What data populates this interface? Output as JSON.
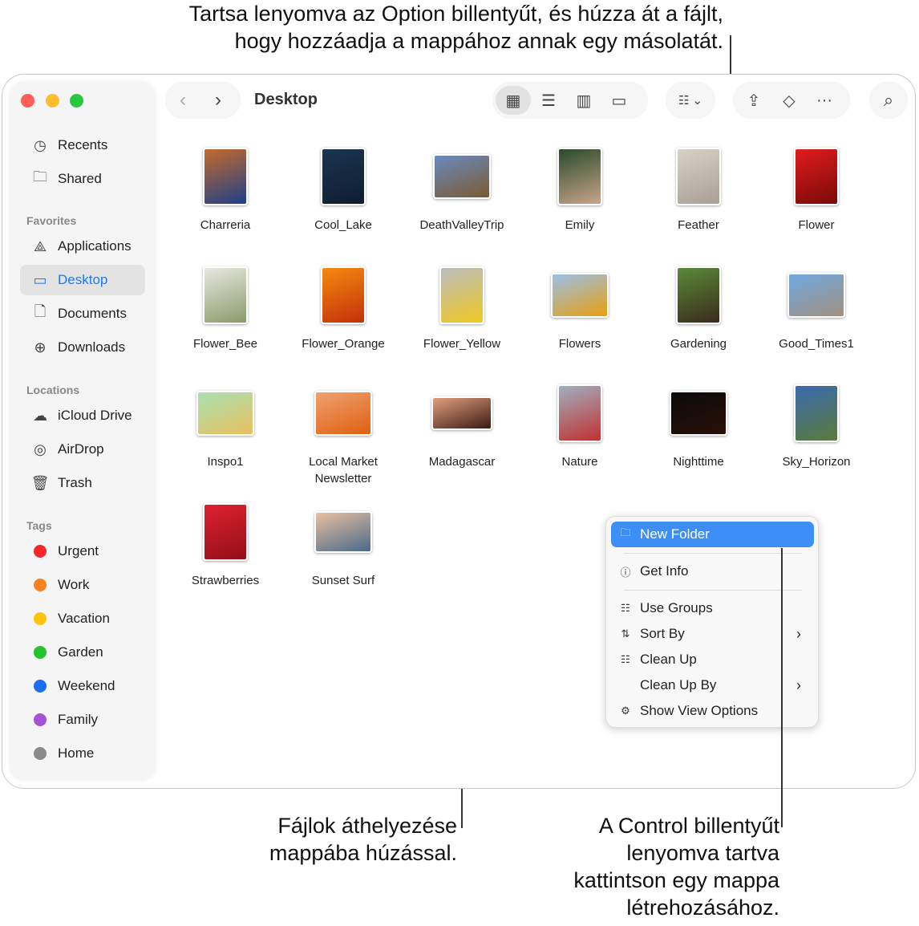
{
  "callouts": {
    "top": [
      "Tartsa lenyomva az Option billentyűt, és húzza át a fájlt,",
      "hogy hozzáadja a mappához annak egy másolatát."
    ],
    "middle": [
      "Fájlok áthelyezése",
      "mappába húzással."
    ],
    "right": [
      "A Control billentyűt",
      "lenyomva tartva",
      "kattintson egy mappa",
      "létrehozásához."
    ]
  },
  "window": {
    "title": "Desktop"
  },
  "sidebar": {
    "top": [
      {
        "label": "Recents",
        "icon": "clock-icon"
      },
      {
        "label": "Shared",
        "icon": "shared-folder-icon"
      }
    ],
    "favorites_heading": "Favorites",
    "favorites": [
      {
        "label": "Applications",
        "icon": "applications-icon"
      },
      {
        "label": "Desktop",
        "icon": "desktop-icon",
        "selected": true
      },
      {
        "label": "Documents",
        "icon": "document-icon"
      },
      {
        "label": "Downloads",
        "icon": "download-icon"
      }
    ],
    "locations_heading": "Locations",
    "locations": [
      {
        "label": "iCloud Drive",
        "icon": "cloud-icon"
      },
      {
        "label": "AirDrop",
        "icon": "airdrop-icon"
      },
      {
        "label": "Trash",
        "icon": "trash-icon"
      }
    ],
    "tags_heading": "Tags",
    "tags": [
      {
        "label": "Urgent",
        "color": "#f2262b"
      },
      {
        "label": "Work",
        "color": "#f6821f"
      },
      {
        "label": "Vacation",
        "color": "#fbc40b"
      },
      {
        "label": "Garden",
        "color": "#27c22f"
      },
      {
        "label": "Weekend",
        "color": "#1d6ff2"
      },
      {
        "label": "Family",
        "color": "#a651d6"
      },
      {
        "label": "Home",
        "color": "#8a8a8a"
      }
    ]
  },
  "files": [
    {
      "name": "Charreria",
      "c1": "#c46a2a",
      "c2": "#1f3f8a"
    },
    {
      "name": "Cool_Lake",
      "c1": "#1b3550",
      "c2": "#0d1d30"
    },
    {
      "name": "DeathValleyTrip",
      "c1": "#6a8ac0",
      "c2": "#7a5a30"
    },
    {
      "name": "Emily",
      "c1": "#2a4a2a",
      "c2": "#c9a48a"
    },
    {
      "name": "Feather",
      "c1": "#d8d2c6",
      "c2": "#a8a094"
    },
    {
      "name": "Flower",
      "c1": "#e01c1c",
      "c2": "#7a0a0a"
    },
    {
      "name": "Flower_Bee",
      "c1": "#e8e8e0",
      "c2": "#8a9a6a"
    },
    {
      "name": "Flower_Orange",
      "c1": "#f58a10",
      "c2": "#c2300a"
    },
    {
      "name": "Flower_Yellow",
      "c1": "#b8bcc0",
      "c2": "#f2c820"
    },
    {
      "name": "Flowers",
      "c1": "#9ac0e8",
      "c2": "#e8a010"
    },
    {
      "name": "Gardening",
      "c1": "#5a8a3a",
      "c2": "#3a2a1a"
    },
    {
      "name": "Good_Times1",
      "c1": "#70a8e0",
      "c2": "#a09080"
    },
    {
      "name": "Inspo1",
      "c1": "#a8e0b0",
      "c2": "#e8c060"
    },
    {
      "name": "Local Market\nNewsletter",
      "c1": "#f0a070",
      "c2": "#e06010"
    },
    {
      "name": "Madagascar",
      "c1": "#e0a080",
      "c2": "#3a1a10"
    },
    {
      "name": "Nature",
      "c1": "#a0b0c0",
      "c2": "#c03030"
    },
    {
      "name": "Nighttime",
      "c1": "#0a0a0a",
      "c2": "#2a1008"
    },
    {
      "name": "Sky_Horizon",
      "c1": "#3a6ab0",
      "c2": "#5a7a3a"
    },
    {
      "name": "Strawberries",
      "c1": "#e02030",
      "c2": "#901018"
    },
    {
      "name": "Sunset Surf",
      "c1": "#e8c0a0",
      "c2": "#4a6a8a"
    }
  ],
  "context_menu": {
    "items": [
      {
        "label": "New Folder",
        "icon": "new-folder-icon",
        "highlighted": true
      },
      {
        "label": "Get Info",
        "icon": "info-icon"
      },
      {
        "label": "Use Groups",
        "icon": "groups-icon"
      },
      {
        "label": "Sort By",
        "icon": "sort-icon",
        "submenu": true
      },
      {
        "label": "Clean Up",
        "icon": "grid-icon"
      },
      {
        "label": "Clean Up By",
        "icon": "",
        "submenu": true
      },
      {
        "label": "Show View Options",
        "icon": "gear-icon"
      }
    ]
  }
}
